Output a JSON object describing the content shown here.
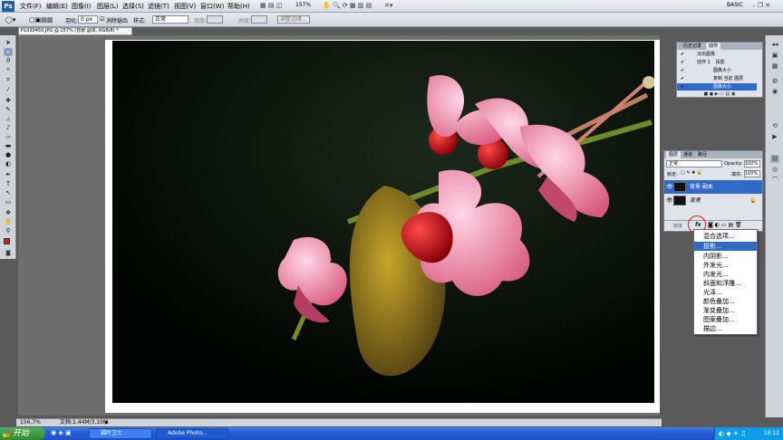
{
  "menubar": {
    "app_icon": "Ps",
    "items": [
      "文件(F)",
      "编辑(E)",
      "图像(I)",
      "图层(L)",
      "选择(S)",
      "滤镜(T)",
      "视图(V)",
      "窗口(W)",
      "帮助(H)"
    ],
    "zoom": "157%",
    "workspace": "BASIC"
  },
  "options": {
    "feather_label": "羽化:",
    "feather_value": "0 px",
    "antialias_label": "消除锯齿",
    "style_label": "样式:",
    "style_value": "正常",
    "width_label": "宽度:",
    "height_label": "高度:",
    "refine_label": "调整边缘..."
  },
  "document": {
    "tab_title": "P1030450.JPG @ 157% (背景 副本, RGB/8) *"
  },
  "status": {
    "zoom": "156.7%",
    "doc_size": "文档:1.44M/3.10M"
  },
  "actions_panel": {
    "tabs": [
      "历史记录",
      "动作"
    ],
    "rows": [
      "淡出图像",
      "动作 1",
      "投影",
      "图像大小",
      "复制 当前 图层",
      "图像大小"
    ]
  },
  "layers_panel": {
    "tabs": [
      "图层",
      "通道",
      "路径"
    ],
    "blend_mode": "正常",
    "opacity_label": "Opacity:",
    "opacity_value": "100%",
    "lock_label": "锁定:",
    "fill_label": "填充:",
    "fill_value": "100%",
    "layers": [
      "背景 副本",
      "背景"
    ],
    "link_label": "链接"
  },
  "context_menu": {
    "items": [
      "混合选项...",
      "投影...",
      "内阴影...",
      "外发光...",
      "内发光...",
      "斜面和浮雕...",
      "光泽...",
      "颜色叠加...",
      "渐变叠加...",
      "图案叠加...",
      "描边..."
    ],
    "highlighted_index": 1
  },
  "taskbar": {
    "start_label": "开始",
    "tasks": [
      "福叶卫士",
      "Adobe Photo..."
    ],
    "clock": "16:12"
  },
  "colors": {
    "foreground": "#e0141a",
    "background": "#ffffff",
    "selection": "#3169c6"
  }
}
